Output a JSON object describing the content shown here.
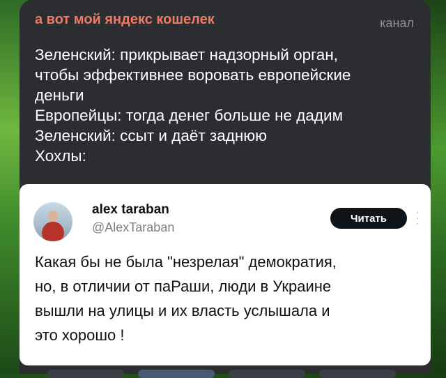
{
  "message": {
    "channel_name": "а вот мой яндекс кошелек",
    "channel_badge": "канал",
    "lines": [
      "Зеленский: прикрывает надзорный орган,",
      "чтобы эффективнее воровать европейские",
      "деньги",
      "Европейцы: тогда денег больше не дадим",
      "Зеленский: ссыт и даёт заднюю",
      "Хохлы:"
    ]
  },
  "tweet": {
    "author_name": "alex taraban",
    "author_handle": "@AlexTaraban",
    "read_button": "Читать",
    "body_lines": [
      "Какая бы не была \"незрелая\" демократия,",
      "но, в отличии от паРаши, люди в Украине",
      "вышли на улицы и их власть услышала и",
      "это хорошо !"
    ]
  },
  "colors": {
    "channel_name": "#f07a63",
    "bubble_bg": "#2b2d31",
    "embed_bg": "#ffffff",
    "button_bg": "#0f1419"
  },
  "icons": {
    "more": "more-vertical-icon",
    "avatar": "avatar"
  }
}
